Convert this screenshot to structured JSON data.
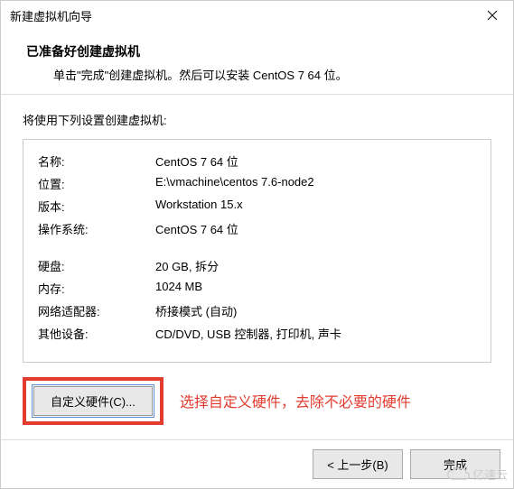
{
  "titlebar": {
    "title": "新建虚拟机向导"
  },
  "header": {
    "title": "已准备好创建虚拟机",
    "subtitle": "单击\"完成\"创建虚拟机。然后可以安装 CentOS 7 64 位。"
  },
  "body": {
    "intro": "将使用下列设置创建虚拟机:",
    "rows": [
      {
        "key": "名称:",
        "val": "CentOS 7 64 位"
      },
      {
        "key": "位置:",
        "val": "E:\\vmachine\\centos 7.6-node2"
      },
      {
        "key": "版本:",
        "val": "Workstation 15.x"
      },
      {
        "key": "操作系统:",
        "val": "CentOS 7 64 位"
      }
    ],
    "rows2": [
      {
        "key": "硬盘:",
        "val": "20 GB, 拆分"
      },
      {
        "key": "内存:",
        "val": "1024 MB"
      },
      {
        "key": "网络适配器:",
        "val": "桥接模式 (自动)"
      },
      {
        "key": "其他设备:",
        "val": "CD/DVD, USB 控制器, 打印机, 声卡"
      }
    ],
    "custom_button": "自定义硬件(C)...",
    "annotation": "选择自定义硬件，去除不必要的硬件"
  },
  "footer": {
    "back": "< 上一步(B)",
    "finish": "完成",
    "cancel_hidden": true
  },
  "watermark": "亿速云"
}
